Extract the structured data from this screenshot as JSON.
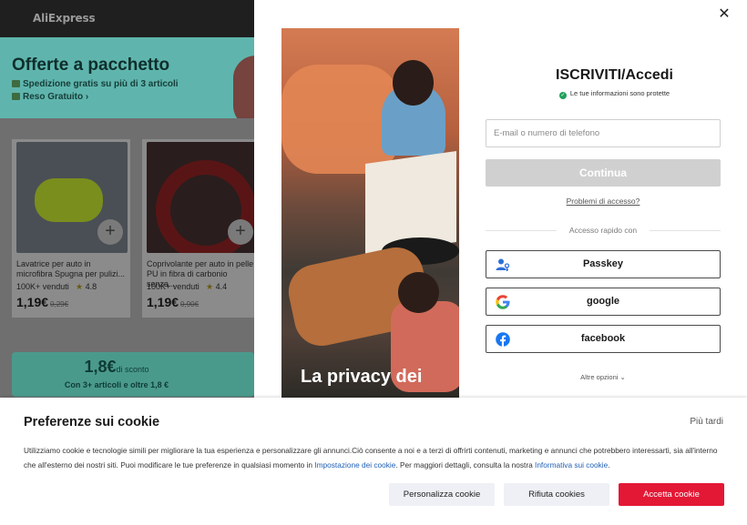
{
  "background": {
    "logo": "AliExpress",
    "promo": {
      "title": "Offerte a pacchetto",
      "line1": "Spedizione gratis su più di 3 articoli",
      "line2": "Reso Gratuito",
      "line2_arrow": "›"
    },
    "products": [
      {
        "name": "Lavatrice per auto in microfibra Spugna per pulizi...",
        "sold": "100K+ venduti",
        "rating": "4.8",
        "price": "1,19€",
        "old_price": "0,29€"
      },
      {
        "name": "Coprivolante per auto in pelle PU in fibra di carbonio senza...",
        "sold": "100K+ venduti",
        "rating": "4.4",
        "price": "1,19€",
        "old_price": "0,90€"
      }
    ],
    "bundle": {
      "amount": "1,8€",
      "amount_suffix": "di sconto",
      "subtitle": "Con 3+ articoli e oltre 1,8 €"
    }
  },
  "login": {
    "close_icon": "close-icon",
    "hero_caption": "La privacy dei",
    "title": "ISCRIVITI/Accedi",
    "secure_text": "Le tue informazioni sono protette",
    "email_placeholder": "E-mail o numero di telefono",
    "continue_label": "Continua",
    "problems_link": "Problemi di accesso?",
    "divider_text": "Accesso rapido con",
    "social": [
      {
        "label": "Passkey",
        "icon": "passkey-icon"
      },
      {
        "label": "google",
        "icon": "google-icon"
      },
      {
        "label": "facebook",
        "icon": "facebook-icon"
      }
    ],
    "more_options": "Altre opzioni",
    "more_options_arrow": "⌄",
    "colors": {
      "accent_green": "#1fa05a",
      "facebook_blue": "#1877f2",
      "disabled_grey": "#d0d0d0"
    }
  },
  "cookie": {
    "title": "Preferenze sui cookie",
    "later": "Più tardi",
    "text_part1": "Utilizziamo cookie e tecnologie simili per migliorare la tua esperienza e personalizzare gli annunci.Ciò consente a noi e a terzi di offrirti contenuti, marketing e annunci che potrebbero interessarti, sia all'interno che all'esterno dei nostri siti. Puoi modificare le tue preferenze in qualsiasi momento in ",
    "link1": "Impostazione dei cookie",
    "text_part2": ". Per maggiori dettagli, consulta la nostra ",
    "link2": "Informativa sui cookie",
    "text_part3": ".",
    "btn_personalize": "Personalizza cookie",
    "btn_reject": "Rifiuta cookies",
    "btn_accept": "Accetta cookie",
    "colors": {
      "accept": "#e31835",
      "link": "#1f5fb5"
    }
  }
}
